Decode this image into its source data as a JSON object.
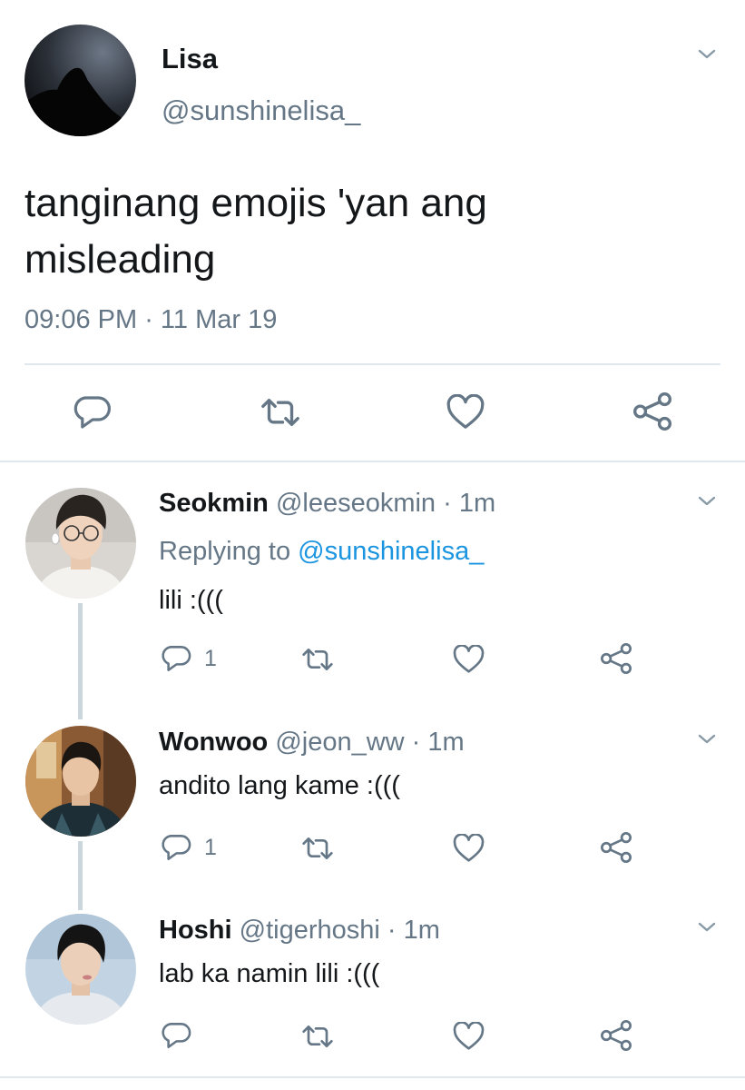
{
  "main_tweet": {
    "display_name": "Lisa",
    "handle": "@sunshinelisa_",
    "text_line1": "tanginang emojis 'yan ang",
    "text_line2": "misleading",
    "time": "09:06 PM",
    "separator": " · ",
    "date": "11 Mar 19",
    "actions": [
      "reply-icon",
      "retweet-icon",
      "like-icon",
      "share-icon"
    ]
  },
  "replies": [
    {
      "display_name": "Seokmin",
      "handle": "@leeseokmin",
      "time": " · 1m",
      "replying_prefix": "Replying to ",
      "replying_handle": "@sunshinelisa_",
      "text": "lili :(((",
      "reply_count": "1"
    },
    {
      "display_name": "Wonwoo",
      "handle": "@jeon_ww",
      "time": " · 1m",
      "text": "andito lang kame :(((",
      "reply_count": "1"
    },
    {
      "display_name": "Hoshi",
      "handle": "@tigerhoshi",
      "time": " · 1m",
      "text": "lab ka namin lili :(((",
      "reply_count": ""
    }
  ],
  "colors": {
    "text": "#14171a",
    "secondary": "#657786",
    "link": "#1b95e0",
    "divider": "#ccd6dd",
    "icon": "#657786"
  }
}
